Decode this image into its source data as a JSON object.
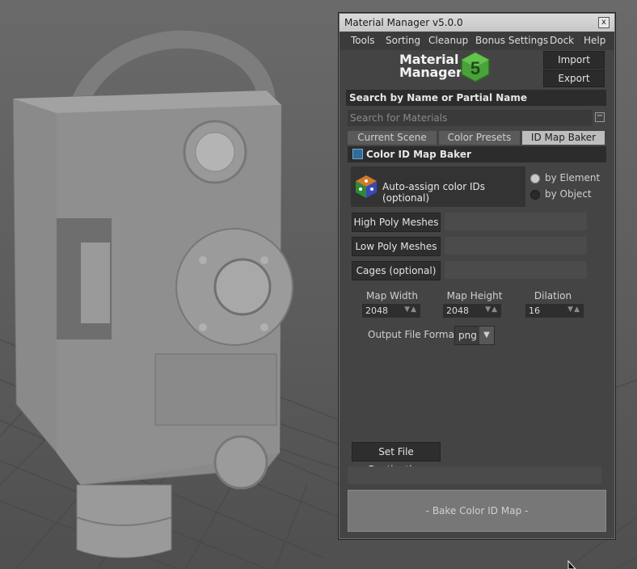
{
  "window": {
    "title": "Material Manager v5.0.0",
    "close_glyph": "x"
  },
  "menu": [
    "Tools",
    "Sorting",
    "Cleanup",
    "Bonus Settings",
    "Dock",
    "Help"
  ],
  "logo": {
    "line1": "Material",
    "line2": "Manager",
    "badge": "5"
  },
  "buttons": {
    "import": "Import",
    "export": "Export"
  },
  "search": {
    "heading": "Search by Name or Partial Name",
    "placeholder": "Search for Materials",
    "collapse_glyph": "−"
  },
  "tabs": [
    {
      "label": "Current Scene",
      "active": false
    },
    {
      "label": "Color Presets",
      "active": false
    },
    {
      "label": "ID Map Baker",
      "active": true
    }
  ],
  "baker": {
    "heading": "Color ID Map Baker",
    "auto_assign_label": "Auto-assign color IDs (optional)",
    "radio": [
      {
        "label": "by Element",
        "checked": true
      },
      {
        "label": "by Object",
        "checked": false
      }
    ],
    "mesh_buttons": [
      "High Poly Meshes",
      "Low Poly Meshes",
      "Cages (optional)"
    ],
    "params": [
      {
        "label": "Map Width",
        "value": "2048"
      },
      {
        "label": "Map Height",
        "value": "2048"
      },
      {
        "label": "Dilation",
        "value": "16"
      }
    ],
    "format_label": "Output File Format:",
    "format_value": "png",
    "dest_button": "Set File Destination",
    "bake_button": "- Bake Color ID Map -"
  },
  "colors": {
    "accent_green": "#4aa23a",
    "swatch_blue": "#2f6c9a"
  }
}
